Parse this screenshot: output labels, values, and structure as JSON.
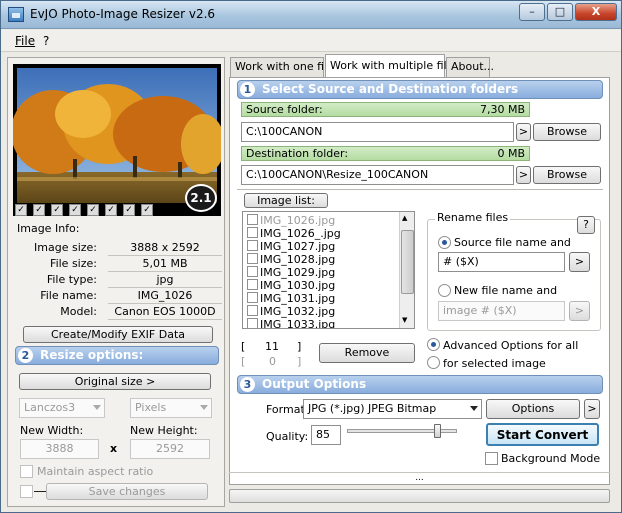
{
  "window": {
    "title": "EvJO Photo-Image Resizer v2.6",
    "minimize": "–",
    "maximize": "□",
    "close": "X"
  },
  "menu": {
    "file": "File",
    "help": "?"
  },
  "preview": {
    "badge": "2.1"
  },
  "image_info": {
    "heading": "Image Info:",
    "rows": [
      {
        "label": "Image size:",
        "value": "3888 x 2592"
      },
      {
        "label": "File size:",
        "value": "5,01 MB"
      },
      {
        "label": "File type:",
        "value": "jpg"
      },
      {
        "label": "File name:",
        "value": "IMG_1026"
      },
      {
        "label": "Model:",
        "value": "Canon EOS 1000D"
      }
    ],
    "exif_button": "Create/Modify EXIF Data"
  },
  "resize": {
    "heading": "Resize options:",
    "number": "2",
    "original_size_button": "Original size >",
    "method": "Lanczos3",
    "unit": "Pixels",
    "new_width_label": "New Width:",
    "new_height_label": "New Height:",
    "width": "3888",
    "height": "2592",
    "times": "x",
    "aspect_label": "Maintain aspect ratio",
    "save_button": "Save changes"
  },
  "tabs": [
    "Work with one file",
    "Work with multiple files",
    "About..."
  ],
  "source": {
    "heading": "Select Source and Destination folders",
    "number": "1",
    "source_label": "Source folder:",
    "source_size": "7,30 MB",
    "source_path": "C:\\100CANON",
    "dest_label": "Destination folder:",
    "dest_size": "0 MB",
    "dest_path": "C:\\100CANON\\Resize_100CANON",
    "browse": "Browse",
    "more": ">"
  },
  "image_list": {
    "button": "Image list:",
    "files": [
      "IMG_1026.jpg",
      "IMG_1026_.jpg",
      "IMG_1027.jpg",
      "IMG_1028.jpg",
      "IMG_1029.jpg",
      "IMG_1030.jpg",
      "IMG_1031.jpg",
      "IMG_1032.jpg",
      "IMG_1033.jpg"
    ],
    "count_total": "11",
    "count_selected": "0",
    "bracket_open": "[",
    "bracket_close": "]",
    "remove_button": "Remove"
  },
  "rename": {
    "heading": "Rename files",
    "help": "?",
    "source_option": "Source file name and",
    "source_pattern": "# ($X)",
    "new_option": "New file name and",
    "new_pattern": "image # ($X)",
    "go": ">"
  },
  "advanced": {
    "all": "Advanced Options for all",
    "selected": "for selected image"
  },
  "output": {
    "heading": "Output Options",
    "number": "3",
    "format_label": "Format:",
    "format_value": "JPG (*.jpg) JPEG Bitmap",
    "options_button": "Options",
    "more": ">",
    "quality_label": "Quality:",
    "quality_value": "85",
    "quality_percent": 85,
    "start_button": "Start Convert",
    "background_label": "Background Mode"
  },
  "status": {
    "dots": "..."
  }
}
